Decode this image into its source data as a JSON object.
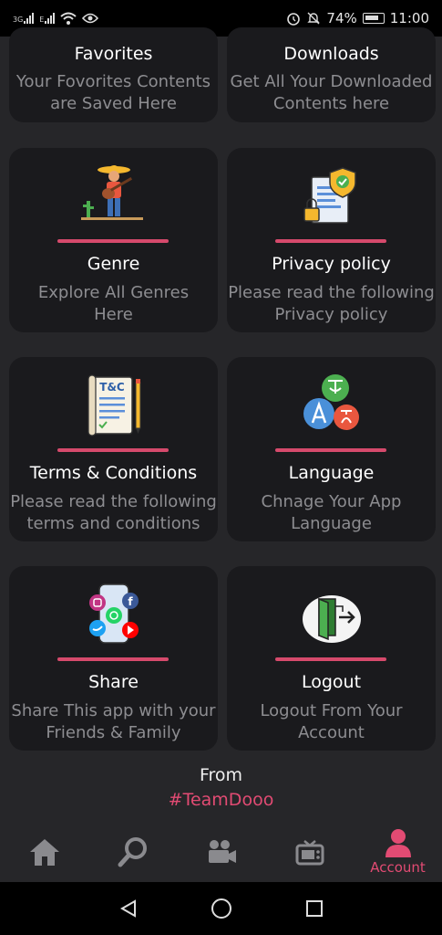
{
  "status_bar": {
    "network_1": "3G",
    "network_2": "E",
    "battery": "74%",
    "time": "11:00"
  },
  "cards": [
    {
      "title": "Favorites",
      "desc": [
        "Your Fovorites Contents",
        "are Saved Here"
      ]
    },
    {
      "title": "Downloads",
      "desc": [
        "Get All Your Downloaded",
        "Contents here"
      ]
    },
    {
      "title": "Genre",
      "desc": [
        "Explore All Genres",
        "Here"
      ]
    },
    {
      "title": "Privacy policy",
      "desc": [
        "Please read the following",
        "Privacy policy"
      ]
    },
    {
      "title": "Terms & Conditions",
      "desc": [
        "Please read the following",
        "terms and conditions"
      ]
    },
    {
      "title": "Language",
      "desc": [
        "Chnage Your App",
        "Language"
      ]
    },
    {
      "title": "Share",
      "desc": [
        "Share This app with your",
        "Friends & Family"
      ]
    },
    {
      "title": "Logout",
      "desc": [
        "Logout From Your",
        "Account"
      ]
    }
  ],
  "terms_icon_text": "T&C",
  "footer": {
    "from": "From",
    "tag": "#TeamDooo"
  },
  "tabs": [
    {
      "icon": "home-icon"
    },
    {
      "icon": "search-icon"
    },
    {
      "icon": "video-camera-icon"
    },
    {
      "icon": "tv-icon"
    },
    {
      "icon": "account-icon",
      "label": "Account"
    }
  ],
  "colors": {
    "accent": "#e24b73",
    "card_bg": "#1a1a1d",
    "page_bg": "#262629",
    "divider": "#d64a6c"
  }
}
